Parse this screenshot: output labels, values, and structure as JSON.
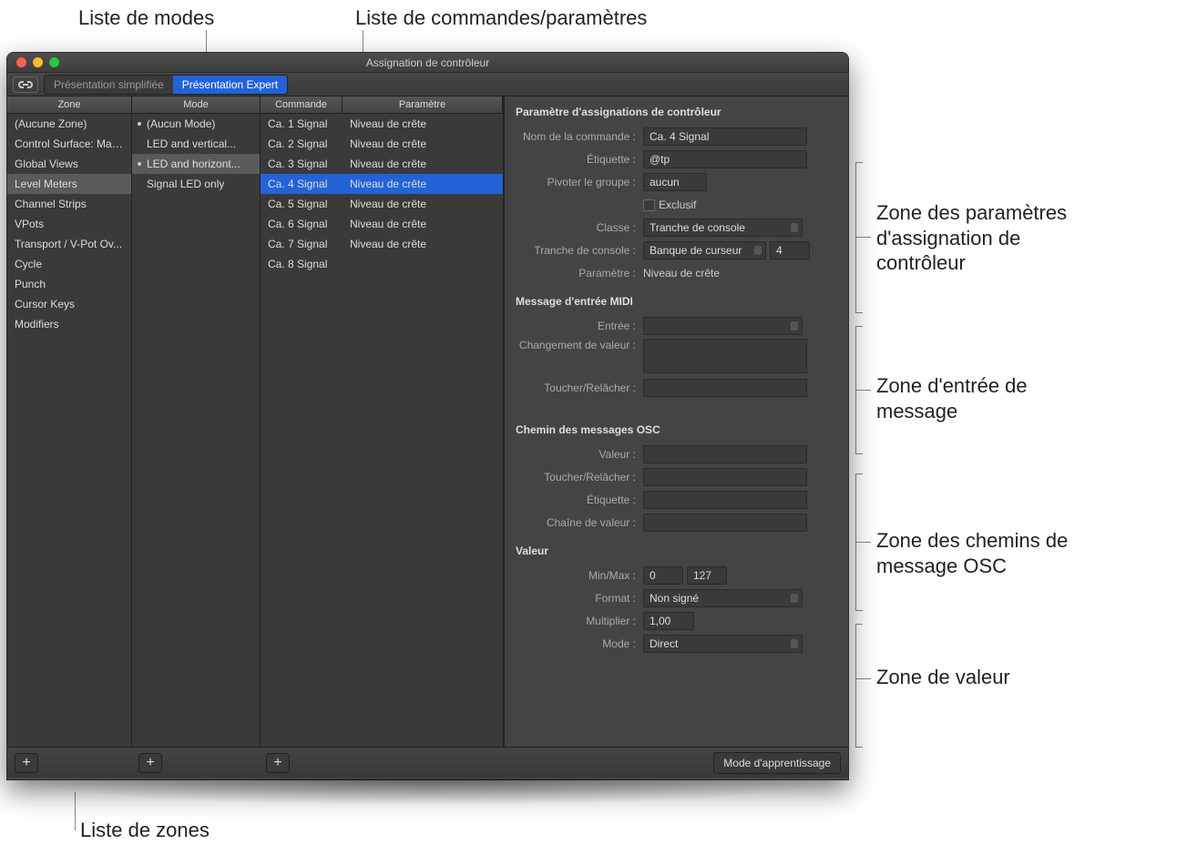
{
  "callouts": {
    "modes_list": "Liste de modes",
    "commands_list": "Liste de commandes/paramètres",
    "zones_list": "Liste de zones",
    "assign_params": "Zone des paramètres d'assignation de contrôleur",
    "message_input": "Zone d'entrée de message",
    "osc_paths": "Zone des chemins de message OSC",
    "value_zone": "Zone de valeur"
  },
  "window": {
    "title": "Assignation de contrôleur",
    "toolbar": {
      "tab_easy": "Présentation simplifiée",
      "tab_expert": "Présentation Expert"
    },
    "headers": {
      "zone": "Zone",
      "mode": "Mode",
      "command": "Commande",
      "parameter": "Paramètre"
    },
    "zones": [
      "(Aucune Zone)",
      "Control Surface: Mac...",
      "Global Views",
      "Level Meters",
      "Channel Strips",
      "VPots",
      "Transport / V-Pot Ov...",
      "Cycle",
      "Punch",
      "Cursor Keys",
      "Modifiers"
    ],
    "zones_selected_index": 3,
    "modes": [
      {
        "label": "(Aucun Mode)",
        "dot": true,
        "selected": false
      },
      {
        "label": "LED and vertical...",
        "dot": false,
        "selected": false
      },
      {
        "label": "LED and horizont...",
        "dot": true,
        "selected": true
      },
      {
        "label": "Signal LED only",
        "dot": false,
        "selected": false
      }
    ],
    "commands": [
      {
        "cmd": "Ca. 1 Signal",
        "param": "Niveau de crête"
      },
      {
        "cmd": "Ca. 2 Signal",
        "param": "Niveau de crête"
      },
      {
        "cmd": "Ca. 3 Signal",
        "param": "Niveau de crête"
      },
      {
        "cmd": "Ca. 4 Signal",
        "param": "Niveau de crête"
      },
      {
        "cmd": "Ca. 5 Signal",
        "param": "Niveau de crête"
      },
      {
        "cmd": "Ca. 6 Signal",
        "param": "Niveau de crête"
      },
      {
        "cmd": "Ca. 7 Signal",
        "param": "Niveau de crête"
      },
      {
        "cmd": "Ca. 8 Signal",
        "param": ""
      }
    ],
    "commands_selected_index": 3,
    "inspector": {
      "section_assign": "Paramètre d'assignations de contrôleur",
      "fields": {
        "command_name_label": "Nom de la commande :",
        "command_name_value": "Ca. 4 Signal",
        "etiquette_label": "Étiquette :",
        "etiquette_value": "@tp",
        "flip_group_label": "Pivoter le groupe :",
        "flip_group_value": "aucun",
        "exclusive_label": "Exclusif",
        "classe_label": "Classe :",
        "classe_value": "Tranche de console",
        "tranche_label": "Tranche de console :",
        "tranche_value": "Banque de curseur",
        "tranche_number": "4",
        "parametre_label": "Paramètre :",
        "parametre_value": "Niveau de crête"
      },
      "section_midi": "Message d'entrée MIDI",
      "midi": {
        "entree_label": "Entrée :",
        "change_label": "Changement de valeur :",
        "touch_label": "Toucher/Relâcher :"
      },
      "section_osc": "Chemin des messages OSC",
      "osc": {
        "valeur_label": "Valeur :",
        "touch_label": "Toucher/Relâcher :",
        "etiquette_label": "Étiquette :",
        "chain_label": "Chaîne de valeur :"
      },
      "section_value": "Valeur",
      "value": {
        "minmax_label": "Min/Max :",
        "min": "0",
        "max": "127",
        "format_label": "Format :",
        "format_value": "Non signé",
        "multiplier_label": "Multiplier :",
        "multiplier_value": "1,00",
        "mode_label": "Mode :",
        "mode_value": "Direct"
      }
    },
    "footer": {
      "learn": "Mode d'apprentissage"
    }
  }
}
